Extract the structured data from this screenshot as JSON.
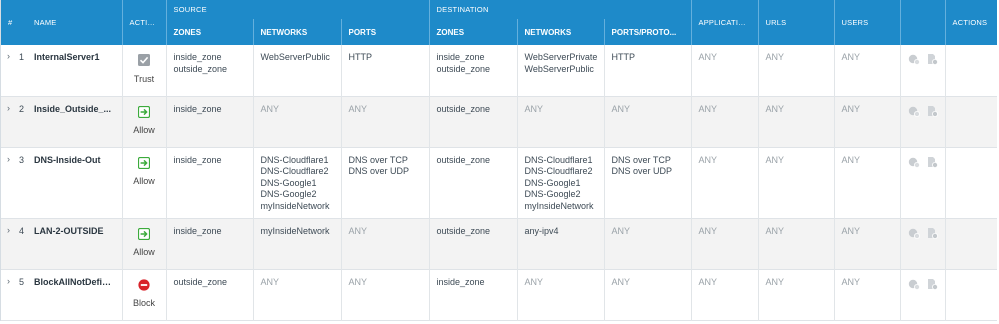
{
  "header": {
    "group_source": "SOURCE",
    "group_destination": "DESTINATION",
    "col_num": "#",
    "col_name": "NAME",
    "col_action": "ACTION",
    "col_src_zones": "ZONES",
    "col_src_networks": "NETWORKS",
    "col_src_ports": "PORTS",
    "col_dst_zones": "ZONES",
    "col_dst_networks": "NETWORKS",
    "col_dst_ports": "PORTS/PROTO...",
    "col_applications": "APPLICATIONS",
    "col_urls": "URLS",
    "col_users": "USERS",
    "col_actions": "ACTIONS"
  },
  "rules": [
    {
      "num": "1",
      "name": "InternalServer1",
      "action": "Trust",
      "action_icon": "trust-check-icon",
      "src_zones": "inside_zone\noutside_zone",
      "src_networks": "WebServerPublic",
      "src_ports": "HTTP",
      "dst_zones": "inside_zone\noutside_zone",
      "dst_networks": "WebServerPrivate\nWebServerPublic",
      "dst_ports": "HTTP",
      "applications": "ANY",
      "urls": "ANY",
      "users": "ANY"
    },
    {
      "num": "2",
      "name": "Inside_Outside_...",
      "action": "Allow",
      "action_icon": "allow-arrow-icon",
      "src_zones": "inside_zone",
      "src_networks": "ANY",
      "src_ports": "ANY",
      "dst_zones": "outside_zone",
      "dst_networks": "ANY",
      "dst_ports": "ANY",
      "applications": "ANY",
      "urls": "ANY",
      "users": "ANY"
    },
    {
      "num": "3",
      "name": "DNS-Inside-Out",
      "action": "Allow",
      "action_icon": "allow-arrow-icon",
      "src_zones": "inside_zone",
      "src_networks": "DNS-Cloudflare1\nDNS-Cloudflare2\nDNS-Google1\nDNS-Google2\nmyInsideNetwork",
      "src_ports": "DNS over TCP\nDNS over UDP",
      "dst_zones": "outside_zone",
      "dst_networks": "DNS-Cloudflare1\nDNS-Cloudflare2\nDNS-Google1\nDNS-Google2\nmyInsideNetwork",
      "dst_ports": "DNS over TCP\nDNS over UDP",
      "applications": "ANY",
      "urls": "ANY",
      "users": "ANY"
    },
    {
      "num": "4",
      "name": "LAN-2-OUTSIDE",
      "action": "Allow",
      "action_icon": "allow-arrow-icon",
      "src_zones": "inside_zone",
      "src_networks": "myInsideNetwork",
      "src_ports": "ANY",
      "dst_zones": "outside_zone",
      "dst_networks": "any-ipv4",
      "dst_ports": "ANY",
      "applications": "ANY",
      "urls": "ANY",
      "users": "ANY"
    },
    {
      "num": "5",
      "name": "BlockAllNotDefin...",
      "action": "Block",
      "action_icon": "block-icon",
      "src_zones": "outside_zone",
      "src_networks": "ANY",
      "src_ports": "ANY",
      "dst_zones": "inside_zone",
      "dst_networks": "ANY",
      "dst_ports": "ANY",
      "applications": "ANY",
      "urls": "ANY",
      "users": "ANY"
    }
  ]
}
